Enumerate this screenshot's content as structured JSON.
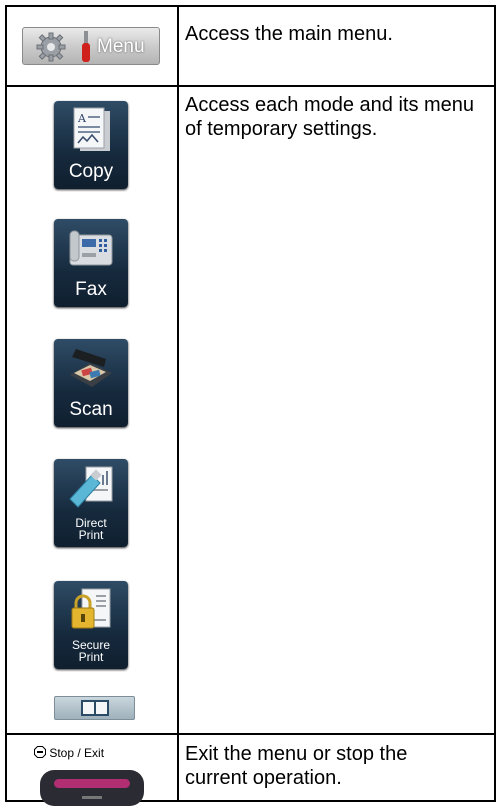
{
  "rows": [
    {
      "key": "menu",
      "button_label": "Menu",
      "description": "Access the main menu."
    },
    {
      "key": "modes",
      "description": "Access each mode and its menu of temporary settings."
    },
    {
      "key": "stop",
      "button_label": "Stop / Exit",
      "description": "Exit the menu or stop the current operation."
    }
  ],
  "modes": [
    {
      "label": "Copy",
      "icon": "copy-icon"
    },
    {
      "label": "Fax",
      "icon": "fax-icon"
    },
    {
      "label": "Scan",
      "icon": "scan-icon"
    },
    {
      "label_line1": "Direct",
      "label_line2": "Print",
      "icon": "direct-print-icon"
    },
    {
      "label_line1": "Secure",
      "label_line2": "Print",
      "icon": "secure-print-icon"
    }
  ],
  "icons": {
    "menu": "gear-wrench-icon",
    "book": "open-book-icon",
    "stop": "stop-icon"
  },
  "colors": {
    "tile": "#1d3246",
    "stop_bar": "#b12e72",
    "menu_accent": "#d0201c"
  }
}
